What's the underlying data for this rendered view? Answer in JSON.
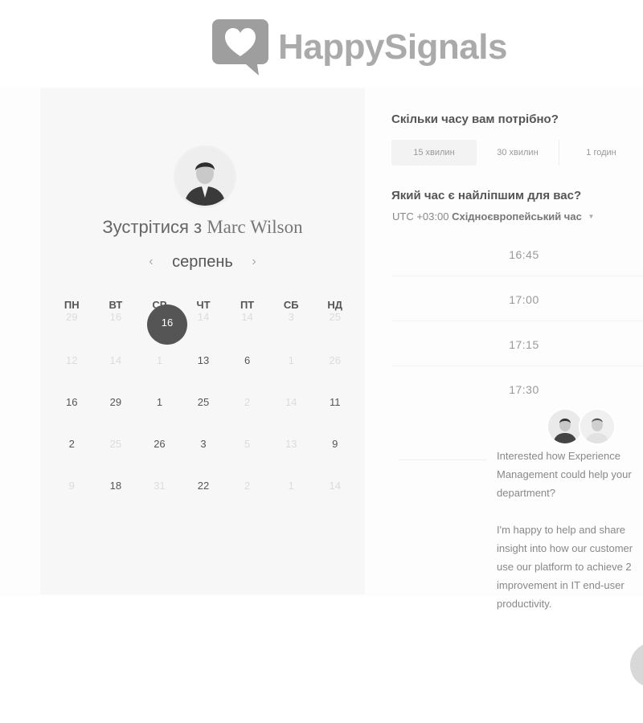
{
  "brand": {
    "name": "HappySignals"
  },
  "host": {
    "prefix": "Зустрітися з",
    "name": "Marc Wilson"
  },
  "calendar": {
    "month": "серпень",
    "weekdays": [
      "ПН",
      "ВТ",
      "СР",
      "ЧТ",
      "ПТ",
      "СБ",
      "НД"
    ],
    "selected": "16",
    "rows": [
      [
        {
          "d": "29",
          "dim": true
        },
        {
          "d": "16",
          "dim": true
        },
        {
          "d": "",
          "dim": true
        },
        {
          "d": "14",
          "dim": true
        },
        {
          "d": "14",
          "dim": true
        },
        {
          "d": "3",
          "dim": true
        },
        {
          "d": "25",
          "dim": true
        }
      ],
      [
        {
          "d": "12",
          "dim": true
        },
        {
          "d": "14",
          "dim": true
        },
        {
          "d": "1",
          "dim": true
        },
        {
          "d": "13",
          "dim": false
        },
        {
          "d": "6",
          "dim": false
        },
        {
          "d": "1",
          "dim": true
        },
        {
          "d": "26",
          "dim": true
        }
      ],
      [
        {
          "d": "16",
          "dim": false
        },
        {
          "d": "29",
          "dim": false
        },
        {
          "d": "1",
          "dim": false
        },
        {
          "d": "25",
          "dim": false
        },
        {
          "d": "2",
          "dim": true
        },
        {
          "d": "14",
          "dim": true
        },
        {
          "d": "11",
          "dim": false
        }
      ],
      [
        {
          "d": "2",
          "dim": false
        },
        {
          "d": "25",
          "dim": true
        },
        {
          "d": "26",
          "dim": false
        },
        {
          "d": "3",
          "dim": false
        },
        {
          "d": "5",
          "dim": true
        },
        {
          "d": "13",
          "dim": true
        },
        {
          "d": "9",
          "dim": false
        }
      ],
      [
        {
          "d": "9",
          "dim": true
        },
        {
          "d": "18",
          "dim": false
        },
        {
          "d": "31",
          "dim": true
        },
        {
          "d": "22",
          "dim": false
        },
        {
          "d": "2",
          "dim": true
        },
        {
          "d": "1",
          "dim": true
        },
        {
          "d": "14",
          "dim": true
        }
      ]
    ]
  },
  "duration": {
    "question": "Скільки часу вам потрібно?",
    "options": [
      "15 хвилин",
      "30 хвилин",
      "1 годин"
    ]
  },
  "time": {
    "question": "Який час є найліпшим для вас?",
    "tz_offset": "UTC +03:00",
    "tz_name": "Східноєвропейський час",
    "slots": [
      "16:45",
      "17:00",
      "17:15",
      "17:30"
    ]
  },
  "popup": {
    "para1": "Interested how Experience\nManagement could help your\ndepartment?",
    "para2": "I'm happy to help and share\ninsight into how our customer\nuse our platform to achieve 2\nimprovement in IT end-user\nproductivity."
  }
}
